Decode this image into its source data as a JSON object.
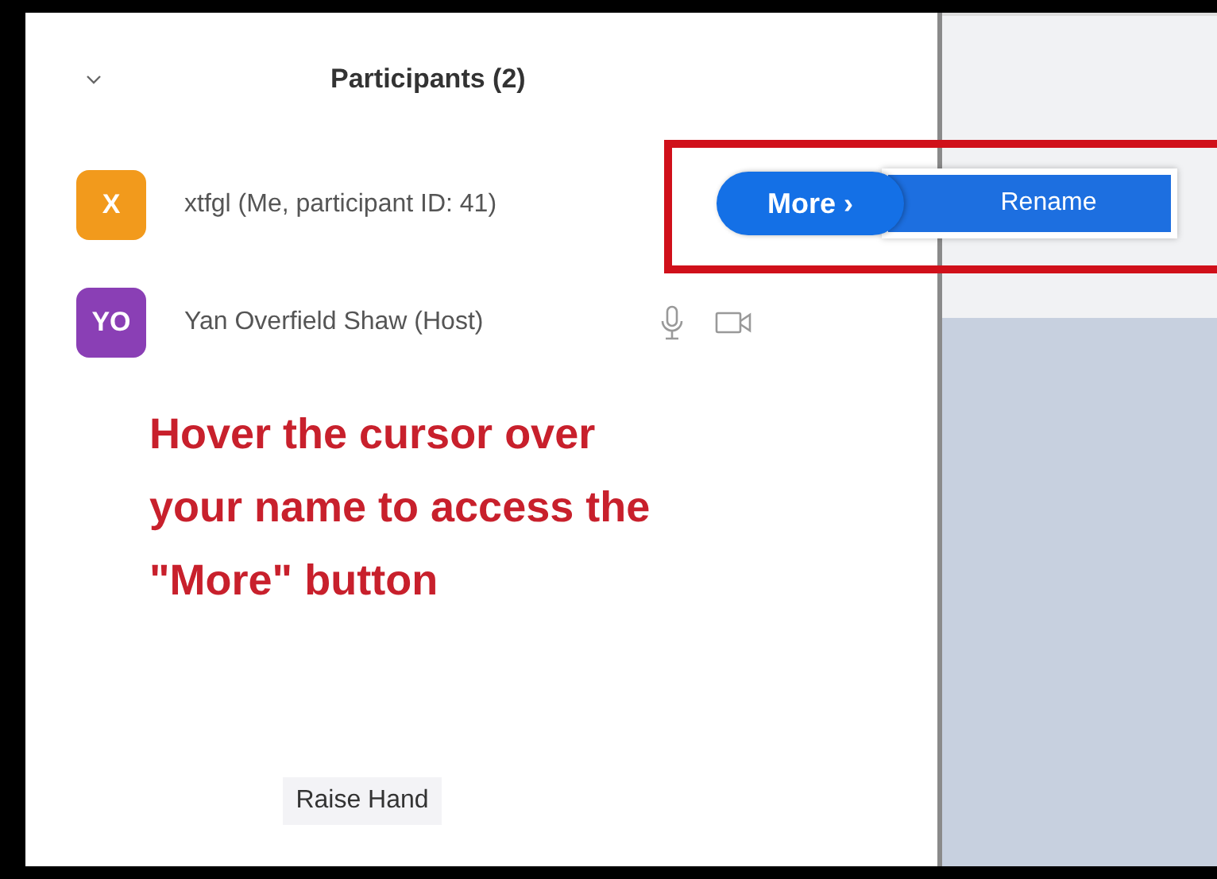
{
  "panel": {
    "title": "Participants (2)"
  },
  "participants": [
    {
      "initials": "X",
      "name": "xtfgl (Me, participant ID: 41)",
      "color": "#f29a1c",
      "media_icons": false,
      "more_button": "More ›"
    },
    {
      "initials": "YO",
      "name": "Yan Overfield Shaw (Host)",
      "color": "#8a3fb5",
      "media_icons": true
    }
  ],
  "menu": {
    "items": [
      "Rename"
    ]
  },
  "annotation": "Hover the cursor over your name to access the \"More\" button",
  "raise_hand_button": "Raise Hand"
}
